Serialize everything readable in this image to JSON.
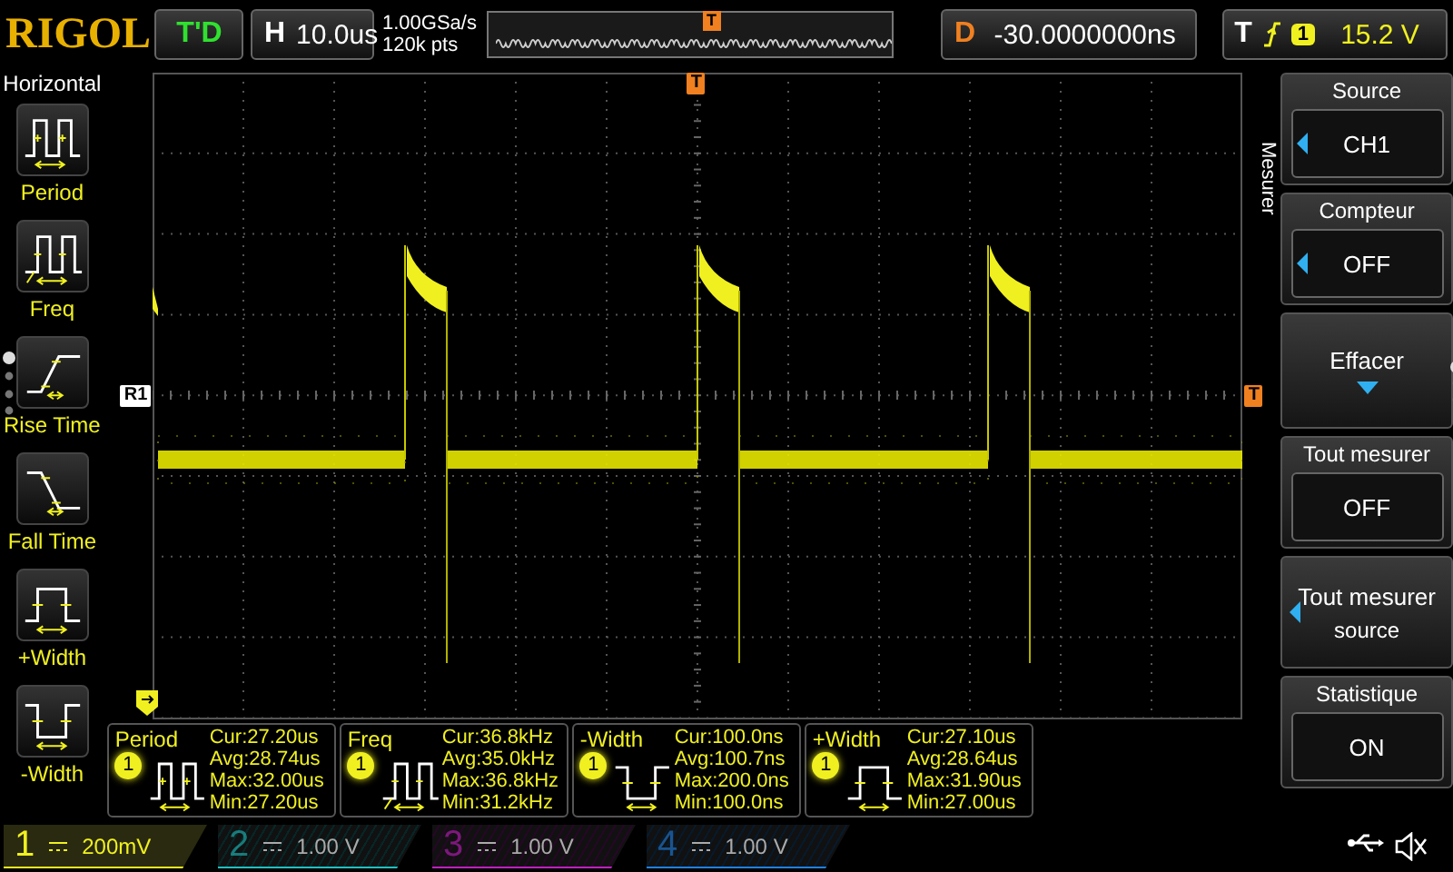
{
  "brand": "RIGOL",
  "trigger_status": "T'D",
  "timebase": {
    "label": "H",
    "value": "10.0us"
  },
  "acquisition": {
    "sample_rate": "1.00GSa/s",
    "memory_depth": "120k pts"
  },
  "overview": {
    "trigger_mark": "T"
  },
  "delay": {
    "label": "D",
    "value": "-30.0000000ns"
  },
  "trigger": {
    "label": "T",
    "source": "1",
    "voltage": "15.2 V"
  },
  "markers": {
    "trigger_position": "T",
    "reference": "R1",
    "trigger_level": "T"
  },
  "left_menu": {
    "title": "Horizontal",
    "items": [
      {
        "label": "Period",
        "kind": "period"
      },
      {
        "label": "Freq",
        "kind": "freq"
      },
      {
        "label": "Rise Time",
        "kind": "rise"
      },
      {
        "label": "Fall Time",
        "kind": "fall"
      },
      {
        "label": "+Width",
        "kind": "pwidth"
      },
      {
        "label": "-Width",
        "kind": "nwidth"
      }
    ]
  },
  "right_menu": {
    "title": "Mesurer",
    "items": [
      {
        "kind": "select",
        "title": "Source",
        "value": "CH1"
      },
      {
        "kind": "select",
        "title": "Compteur",
        "value": "OFF"
      },
      {
        "kind": "submenu",
        "label": "Effacer"
      },
      {
        "kind": "toggle",
        "title": "Tout mesurer",
        "value": "OFF"
      },
      {
        "kind": "choice",
        "label": "Tout mesurer",
        "sublabel": "source"
      },
      {
        "kind": "toggle",
        "title": "Statistique",
        "value": "ON"
      }
    ]
  },
  "measurements": [
    {
      "name": "Period",
      "source": "1",
      "kind": "period",
      "stats": [
        "Cur:27.20us",
        "Avg:28.74us",
        "Max:32.00us",
        "Min:27.20us"
      ]
    },
    {
      "name": "Freq",
      "source": "1",
      "kind": "freq",
      "stats": [
        "Cur:36.8kHz",
        "Avg:35.0kHz",
        "Max:36.8kHz",
        "Min:31.2kHz"
      ]
    },
    {
      "name": "-Width",
      "source": "1",
      "kind": "nwidth",
      "stats": [
        "Cur:100.0ns",
        "Avg:100.7ns",
        "Max:200.0ns",
        "Min:100.0ns"
      ]
    },
    {
      "name": "+Width",
      "source": "1",
      "kind": "pwidth",
      "stats": [
        "Cur:27.10us",
        "Avg:28.64us",
        "Max:31.90us",
        "Min:27.00us"
      ]
    }
  ],
  "channels": [
    {
      "number": "1",
      "scale": "200mV",
      "on": true,
      "color": "#f0f020"
    },
    {
      "number": "2",
      "scale": "1.00 V",
      "on": false,
      "color": "#20c0c0"
    },
    {
      "number": "3",
      "scale": "1.00 V",
      "on": false,
      "color": "#c020c0"
    },
    {
      "number": "4",
      "scale": "1.00 V",
      "on": false,
      "color": "#2080e0"
    }
  ]
}
